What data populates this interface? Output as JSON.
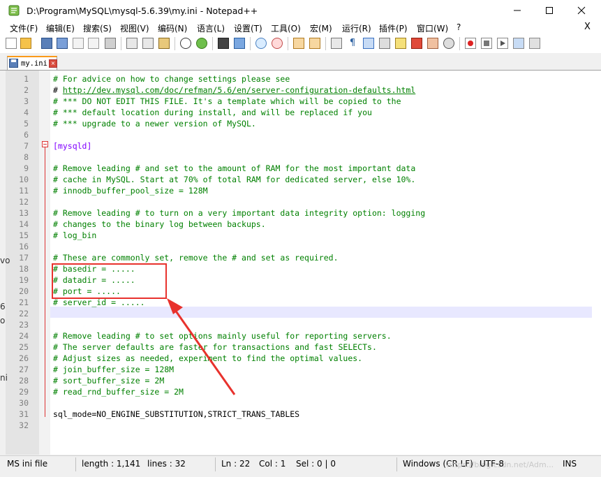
{
  "window": {
    "title": "D:\\Program\\MySQL\\mysql-5.6.39\\my.ini - Notepad++"
  },
  "menu": {
    "items": [
      "文件(F)",
      "编辑(E)",
      "搜索(S)",
      "视图(V)",
      "编码(N)",
      "语言(L)",
      "设置(T)",
      "工具(O)",
      "宏(M)",
      "运行(R)",
      "插件(P)",
      "窗口(W)",
      "?"
    ],
    "close": "X"
  },
  "tab": {
    "label": "my.ini"
  },
  "editor": {
    "lines": [
      {
        "n": "1",
        "t": "# For advice on how to change settings please see",
        "kind": "comment"
      },
      {
        "n": "2",
        "t": "# http://dev.mysql.com/doc/refman/5.6/en/server-configuration-defaults.html",
        "kind": "link"
      },
      {
        "n": "3",
        "t": "# *** DO NOT EDIT THIS FILE. It's a template which will be copied to the",
        "kind": "comment"
      },
      {
        "n": "4",
        "t": "# *** default location during install, and will be replaced if you",
        "kind": "comment"
      },
      {
        "n": "5",
        "t": "# *** upgrade to a newer version of MySQL.",
        "kind": "comment"
      },
      {
        "n": "6",
        "t": "",
        "kind": "plain"
      },
      {
        "n": "7",
        "t": "[mysqld]",
        "kind": "section"
      },
      {
        "n": "8",
        "t": "",
        "kind": "plain"
      },
      {
        "n": "9",
        "t": "# Remove leading # and set to the amount of RAM for the most important data",
        "kind": "comment"
      },
      {
        "n": "10",
        "t": "# cache in MySQL. Start at 70% of total RAM for dedicated server, else 10%.",
        "kind": "comment"
      },
      {
        "n": "11",
        "t": "# innodb_buffer_pool_size = 128M",
        "kind": "comment"
      },
      {
        "n": "12",
        "t": "",
        "kind": "plain"
      },
      {
        "n": "13",
        "t": "# Remove leading # to turn on a very important data integrity option: logging",
        "kind": "comment"
      },
      {
        "n": "14",
        "t": "# changes to the binary log between backups.",
        "kind": "comment"
      },
      {
        "n": "15",
        "t": "# log_bin",
        "kind": "comment"
      },
      {
        "n": "16",
        "t": "",
        "kind": "plain"
      },
      {
        "n": "17",
        "t": "# These are commonly set, remove the # and set as required.",
        "kind": "comment"
      },
      {
        "n": "18",
        "t": "# basedir = .....",
        "kind": "comment"
      },
      {
        "n": "19",
        "t": "# datadir = .....",
        "kind": "comment"
      },
      {
        "n": "20",
        "t": "# port = .....",
        "kind": "comment"
      },
      {
        "n": "21",
        "t": "# server_id = .....",
        "kind": "comment"
      },
      {
        "n": "22",
        "t": "",
        "kind": "plain"
      },
      {
        "n": "23",
        "t": "",
        "kind": "plain"
      },
      {
        "n": "24",
        "t": "# Remove leading # to set options mainly useful for reporting servers.",
        "kind": "comment"
      },
      {
        "n": "25",
        "t": "# The server defaults are faster for transactions and fast SELECTs.",
        "kind": "comment"
      },
      {
        "n": "26",
        "t": "# Adjust sizes as needed, experiment to find the optimal values.",
        "kind": "comment"
      },
      {
        "n": "27",
        "t": "# join_buffer_size = 128M",
        "kind": "comment"
      },
      {
        "n": "28",
        "t": "# sort_buffer_size = 2M",
        "kind": "comment"
      },
      {
        "n": "29",
        "t": "# read_rnd_buffer_size = 2M",
        "kind": "comment"
      },
      {
        "n": "30",
        "t": "",
        "kind": "plain"
      },
      {
        "n": "31",
        "t": "sql_mode=NO_ENGINE_SUBSTITUTION,STRICT_TRANS_TABLES",
        "kind": "plain"
      },
      {
        "n": "32",
        "t": "",
        "kind": "plain"
      }
    ],
    "current_line": "22"
  },
  "status": {
    "file_type": "MS ini file",
    "length": "length : 1,141",
    "lines": "lines : 32",
    "ln": "Ln : 22",
    "col": "Col : 1",
    "sel": "Sel : 0 | 0",
    "eol": "Windows (CR LF)",
    "encoding": "UTF-8",
    "mode": "INS",
    "watermark": "https://blog.csdn.net/Adm..."
  },
  "colors": {
    "comment": "#008000",
    "section": "#8000ff",
    "annotation": "#e8322d",
    "current_line_bg": "#e8e8ff"
  },
  "background_fragments": [
    "vo",
    "6",
    "o",
    "ni"
  ]
}
